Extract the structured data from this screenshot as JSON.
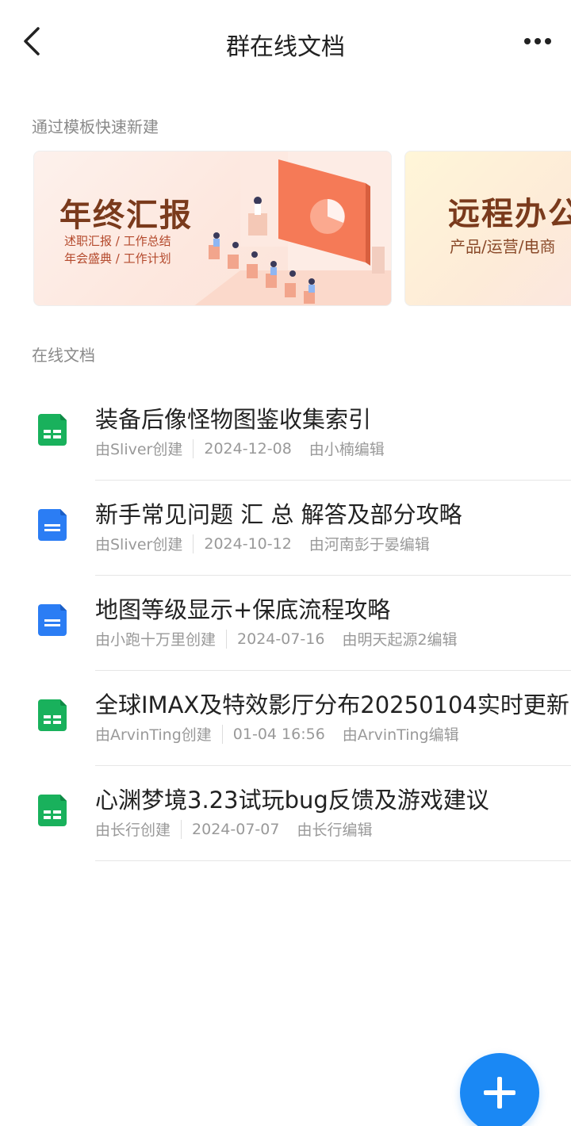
{
  "header": {
    "title": "群在线文档",
    "back_icon": "chevron-left-icon",
    "more_icon": "more-horizontal-icon"
  },
  "templates": {
    "label": "通过模板快速新建",
    "cards": [
      {
        "title": "年终汇报",
        "sub1": "述职汇报 / 工作总结",
        "sub2": "年会盛典 / 工作计划"
      },
      {
        "title": "远程办公",
        "sub1": "产品/运营/电商"
      }
    ]
  },
  "docs": {
    "label": "在线文档",
    "items": [
      {
        "type": "sheet",
        "icon": "spreadsheet-icon",
        "title": "装备后像怪物图鉴收集索引",
        "creator": "由Sliver创建",
        "date": "2024-12-08",
        "editor": "由小楠编辑"
      },
      {
        "type": "doc",
        "icon": "document-icon",
        "title": "新手常见问题 汇 总 解答及部分攻略",
        "creator": "由Sliver创建",
        "date": "2024-10-12",
        "editor": "由河南彭于晏编辑"
      },
      {
        "type": "doc",
        "icon": "document-icon",
        "title": "地图等级显示+保底流程攻略",
        "creator": "由小跑十万里创建",
        "date": "2024-07-16",
        "editor": "由明天起源2编辑"
      },
      {
        "type": "sheet",
        "icon": "spreadsheet-icon",
        "title": "全球IMAX及特效影厅分布20250104实时更新",
        "creator": "由ArvinTing创建",
        "date": "01-04 16:56",
        "editor": "由ArvinTing编辑"
      },
      {
        "type": "sheet",
        "icon": "spreadsheet-icon",
        "title": "心渊梦境3.23试玩bug反馈及游戏建议",
        "creator": "由长行创建",
        "date": "2024-07-07",
        "editor": "由长行编辑"
      }
    ]
  },
  "fab": {
    "icon": "plus-icon"
  },
  "colors": {
    "sheet": "#19b15c",
    "doc": "#2b7df4",
    "accent": "#1a88f4"
  }
}
